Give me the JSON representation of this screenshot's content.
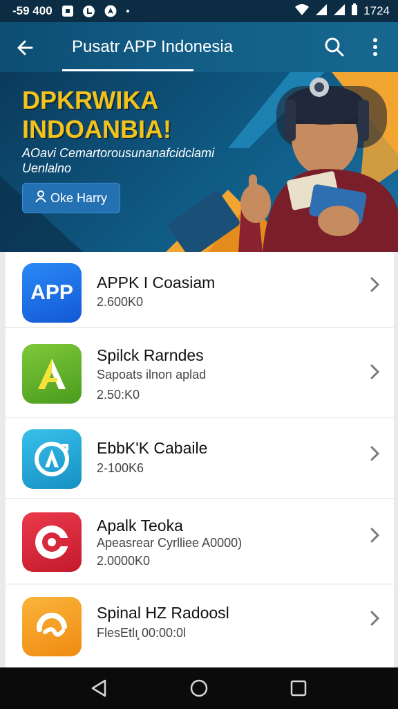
{
  "status_bar": {
    "time_left": "-59 400",
    "clock": "1724",
    "icons": [
      "notification-square-icon",
      "check-circle-icon",
      "navigation-circle-icon",
      "more-dot-icon",
      "wifi-icon",
      "signal-icon",
      "signal-icon",
      "battery-icon"
    ]
  },
  "app_bar": {
    "title": "Pusatr APP Indonesia",
    "icons": [
      "back-arrow-icon",
      "search-icon",
      "overflow-menu-icon"
    ]
  },
  "banner": {
    "headline": "DPKRWIKA\nINDOANBIA!",
    "subtitle": "AOavi Cemartorousunanafcidclami\nUenlalno",
    "cta_label": "Oke Harry",
    "cta_icon": "person-icon",
    "colors": {
      "headline": "#f3c21b",
      "cta": "#2370b2",
      "accent": "#f2a531"
    }
  },
  "apps": [
    {
      "name": "APPK I Coasiam",
      "description": "",
      "meta": "2.600K0",
      "icon": "app-blue-icon",
      "icon_text": "APP",
      "color": "#1a73e8"
    },
    {
      "name": "Spilck Rarndes",
      "description": "Sapoats ilnon aplad",
      "meta": "2.50:K0",
      "icon": "app-a-green-icon",
      "icon_text": "",
      "color": "#5ab02a"
    },
    {
      "name": "EbbK'K Cabaile",
      "description": "",
      "meta": "2-100K6",
      "icon": "app-a-circle-icon",
      "icon_text": "",
      "color": "#1fa3d6"
    },
    {
      "name": "Apalk Teoka",
      "description": "Apeasrear Cyrlliee A0000)",
      "meta": "2.0000K0",
      "icon": "app-red-c-icon",
      "icon_text": "",
      "color": "#d8283a"
    },
    {
      "name": "Spinal HZ Radoosl",
      "description": "",
      "meta": "FlesEtlı̧ 00:00:0l",
      "icon": "app-orange-icon",
      "icon_text": "",
      "color": "#f39a1e"
    }
  ],
  "nav_bar": {
    "icons": [
      "back-triangle-icon",
      "home-circle-icon",
      "recents-square-icon"
    ]
  }
}
